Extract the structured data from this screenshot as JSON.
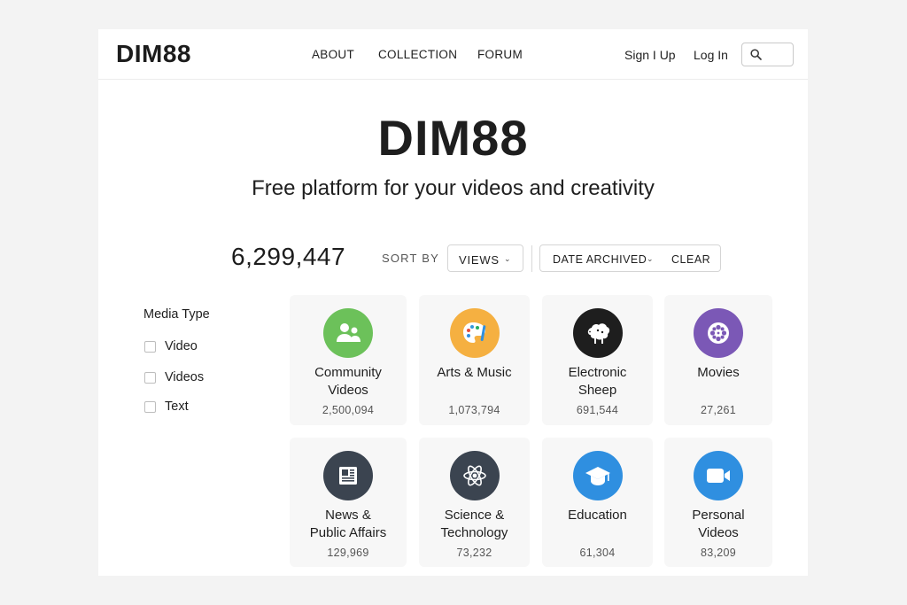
{
  "brand": {
    "logo": "DIM88"
  },
  "nav": {
    "about": "ABOUT",
    "collection": "COLLECTION",
    "forum": "FORUM"
  },
  "auth": {
    "sign_up": "Sign I Up",
    "log_in": "Log In"
  },
  "search": {
    "icon": "search-icon"
  },
  "hero": {
    "title": "DIM88",
    "subtitle": "Free platform for your videos and creativity"
  },
  "toolbar": {
    "total_count": "6,299,447",
    "sort_by_label": "SORT BY",
    "sort_value": "VIEWS",
    "date_filter": "DATE ARCHIVED",
    "clear_label": "CLEAR"
  },
  "facets": {
    "title": "Media Type",
    "items": [
      {
        "label": "Video"
      },
      {
        "label": "Videos"
      },
      {
        "label": "Text"
      }
    ]
  },
  "collections": [
    {
      "line1": "Community",
      "line2": "Videos",
      "count": "2,500,094",
      "icon": "community-icon",
      "color": "#6cc15a"
    },
    {
      "line1": "Arts & Music",
      "line2": "",
      "count": "1,073,794",
      "icon": "palette-icon",
      "color": "#f5b041"
    },
    {
      "line1": "Electronic",
      "line2": "Sheep",
      "count": "691,544",
      "icon": "sheep-icon",
      "color": "#1e1e1e"
    },
    {
      "line1": "Movies",
      "line2": "",
      "count": "27,261",
      "icon": "film-reel-icon",
      "color": "#7b58b6"
    },
    {
      "line1": "News &",
      "line2": "Public Affairs",
      "count": "129,969",
      "icon": "newspaper-icon",
      "color": "#3b4450"
    },
    {
      "line1": "Science &",
      "line2": "Technology",
      "count": "73,232",
      "icon": "atom-icon",
      "color": "#3b4450"
    },
    {
      "line1": "Education",
      "line2": "",
      "count": "61,304",
      "icon": "graduation-cap-icon",
      "color": "#2f8fe0"
    },
    {
      "line1": "Personal",
      "line2": "Videos",
      "count": "83,209",
      "icon": "video-camera-icon",
      "color": "#2f8fe0"
    }
  ]
}
